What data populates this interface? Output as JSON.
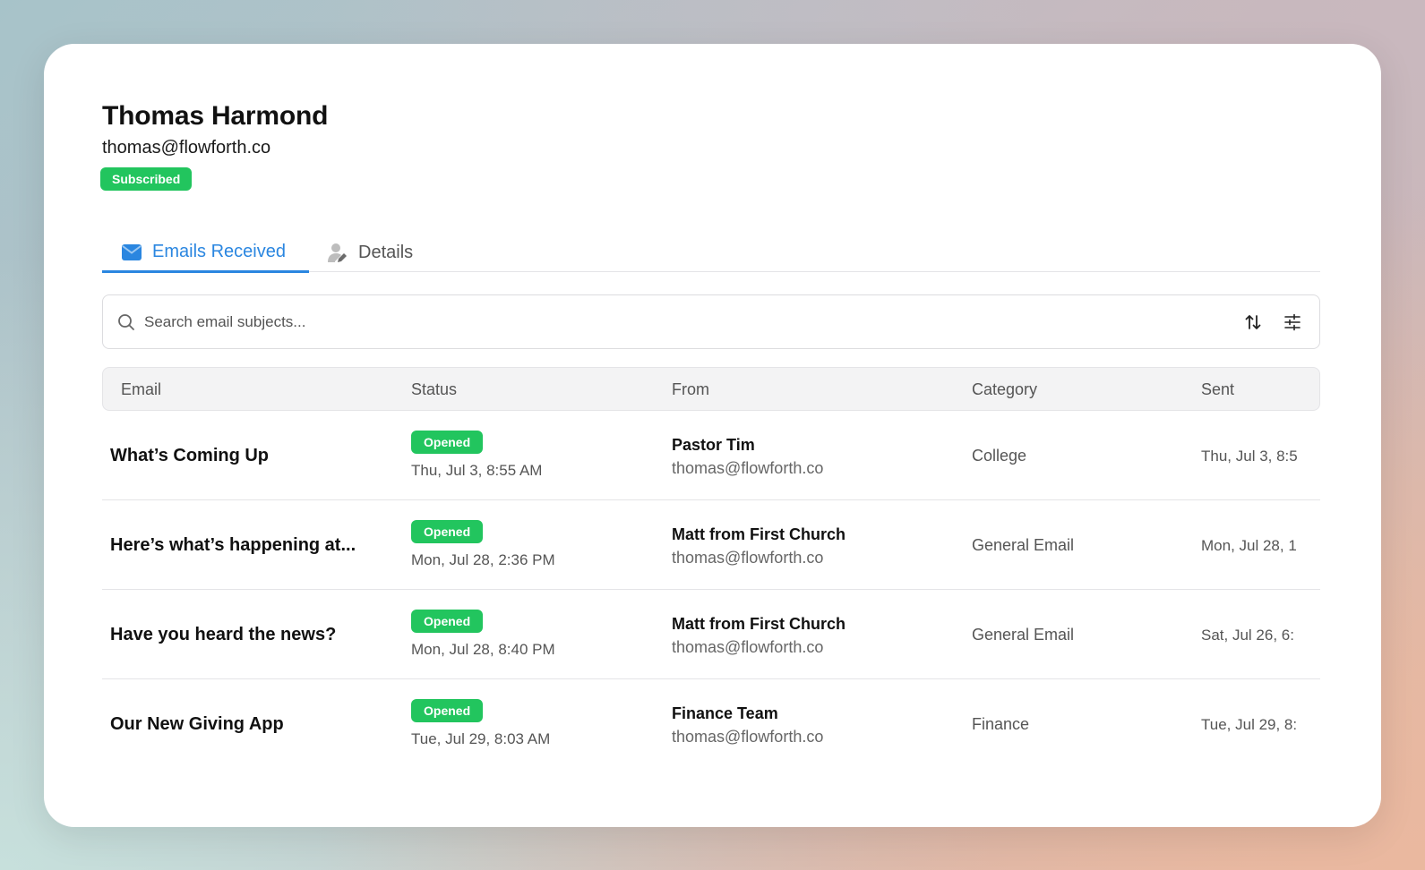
{
  "profile": {
    "name": "Thomas Harmond",
    "email": "thomas@flowforth.co",
    "status_badge": "Subscribed"
  },
  "tabs": [
    {
      "label": "Emails Received",
      "icon": "envelope-icon",
      "active": true
    },
    {
      "label": "Details",
      "icon": "user-edit-icon",
      "active": false
    }
  ],
  "search": {
    "placeholder": "Search email subjects..."
  },
  "table": {
    "columns": [
      "Email",
      "Status",
      "From",
      "Category",
      "Sent"
    ],
    "rows": [
      {
        "email": "What’s Coming Up",
        "status": "Opened",
        "status_date": "Thu, Jul 3, 8:55 AM",
        "from_name": "Pastor Tim",
        "from_email": "thomas@flowforth.co",
        "category": "College",
        "sent": "Thu, Jul 3, 8:5"
      },
      {
        "email": "Here’s what’s happening at...",
        "status": "Opened",
        "status_date": "Mon, Jul 28, 2:36 PM",
        "from_name": "Matt from First Church",
        "from_email": "thomas@flowforth.co",
        "category": "General Email",
        "sent": "Mon, Jul 28, 1"
      },
      {
        "email": "Have you heard the news?",
        "status": "Opened",
        "status_date": "Mon, Jul 28, 8:40 PM",
        "from_name": "Matt from First Church",
        "from_email": "thomas@flowforth.co",
        "category": "General Email",
        "sent": "Sat, Jul 26, 6:"
      },
      {
        "email": "Our New Giving App",
        "status": "Opened",
        "status_date": "Tue, Jul 29, 8:03 AM",
        "from_name": "Finance Team",
        "from_email": "thomas@flowforth.co",
        "category": "Finance",
        "sent": "Tue, Jul 29, 8:"
      }
    ]
  },
  "colors": {
    "accent": "#2a86e0",
    "badge_green": "#22c55e"
  }
}
